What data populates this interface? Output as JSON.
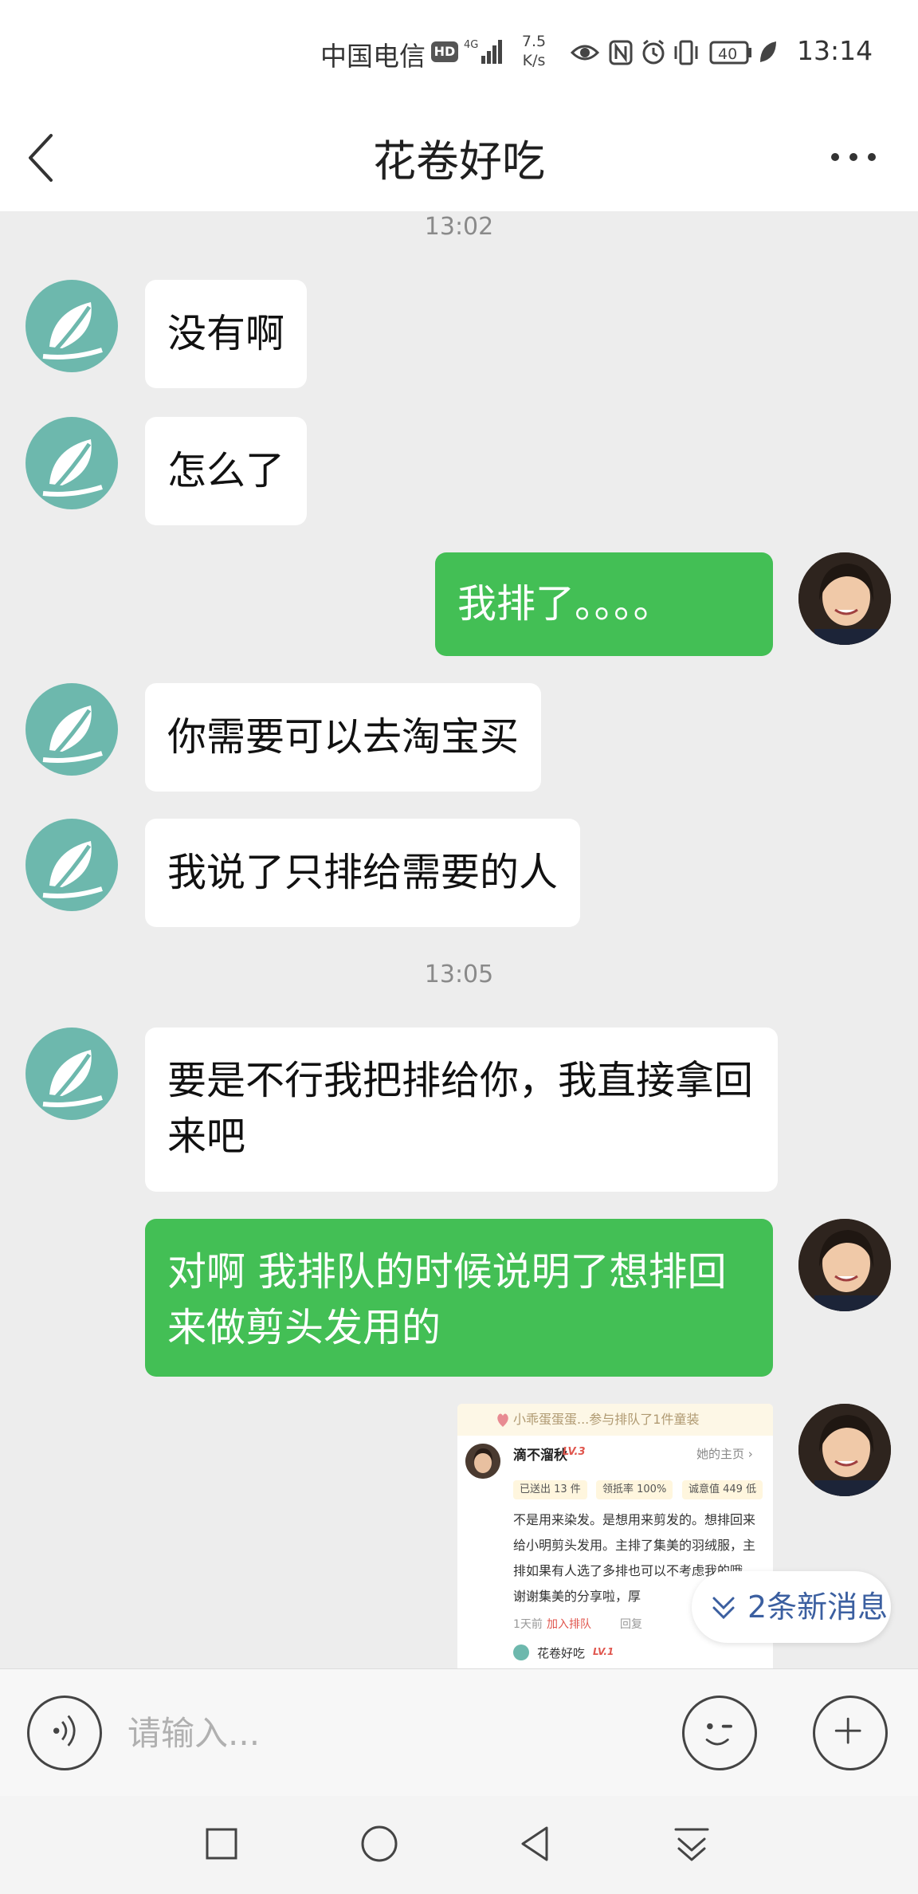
{
  "status_bar": {
    "carrier": "中国电信",
    "hd_badge": "HD",
    "network": "4G",
    "speed_value": "7.5",
    "speed_unit": "K/s",
    "battery": "40",
    "time": "13:14",
    "icons": [
      "eye-icon",
      "nfc-icon",
      "alarm-icon",
      "vibrate-icon",
      "battery-icon",
      "leaf-icon"
    ]
  },
  "nav": {
    "title": "花卷好吃",
    "back_icon": "back-chevron-icon",
    "more_icon": "more-dots-icon"
  },
  "chat": {
    "timestamps": [
      "13:02",
      "13:05"
    ],
    "messages": [
      {
        "side": "in",
        "text": "没有啊"
      },
      {
        "side": "in",
        "text": "怎么了"
      },
      {
        "side": "out",
        "text": "我排了。。。。"
      },
      {
        "side": "in",
        "text": "你需要可以去淘宝买"
      },
      {
        "side": "in",
        "text": "我说了只排给需要的人"
      },
      {
        "side": "in",
        "text": "要是不行我把排给你，我直接拿回来吧"
      },
      {
        "side": "out",
        "text": "对啊 我排队的时候说明了想排回来做剪头发用的"
      }
    ],
    "shared_post": {
      "banner": "小乖蛋蛋蛋...参与排队了1件童装",
      "user_name": "滴不溜秋",
      "user_level": "LV.3",
      "home_link": "她的主页 ›",
      "stats": [
        "已送出 13 件",
        "领抵率 100%",
        "诚意值 449 低"
      ],
      "body": "不是用来染发。是想用来剪发的。想排回来给小明剪头发用。主排了集美的羽绒服，主排如果有人选了多排也可以不考虑我的哦。谢谢集美的分享啦，厚",
      "time_ago": "1天前",
      "action_queue": "加入排队",
      "action_reply": "回复",
      "reply_user": "花卷好吃",
      "reply_level": "LV.1"
    },
    "new_messages_pill": "2条新消息"
  },
  "input_bar": {
    "placeholder": "请输入...",
    "voice_icon": "voice-icon",
    "emoji_icon": "emoji-icon",
    "plus_icon": "plus-icon"
  },
  "system_nav": {
    "icons": [
      "recent-apps-icon",
      "home-icon",
      "back-icon",
      "notification-pull-icon"
    ]
  },
  "colors": {
    "outgoing_bubble": "#43bf55",
    "incoming_bubble": "#ffffff",
    "chat_background": "#ededed",
    "leaf_avatar": "#6db8ad",
    "new_message_text": "#3b5fa0"
  }
}
